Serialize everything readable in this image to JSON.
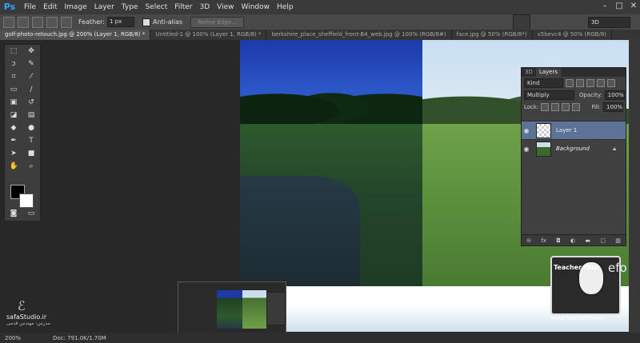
{
  "app": {
    "logo": "Ps"
  },
  "menu": [
    "File",
    "Edit",
    "Image",
    "Layer",
    "Type",
    "Select",
    "Filter",
    "3D",
    "View",
    "Window",
    "Help"
  ],
  "window_controls": [
    "–",
    "□",
    "✕"
  ],
  "options": {
    "feather_label": "Feather:",
    "feather_value": "1 px",
    "antialias_label": "Anti-alias",
    "refine_edge": "Refine Edge...",
    "workspace": "3D"
  },
  "tabs": [
    "golf-photo-retouch.jpg @ 200% (Layer 1, RGB/8) *",
    "Untitled-1 @ 100% (Layer 1, RGB/8) *",
    "berkshire_place_sheffield_front-B4_web.jpg @ 100% (RGB/8#)",
    "face.jpg @ 50% (RGB/8*)",
    "v5bevc4 @ 50% (RGB/8)"
  ],
  "layers_panel": {
    "tabs": [
      "3D",
      "Layers"
    ],
    "kind": "Kind",
    "blend_mode": "Multiply",
    "opacity_label": "Opacity:",
    "opacity_value": "100%",
    "lock_label": "Lock:",
    "fill_label": "Fill:",
    "fill_value": "100%",
    "layers": [
      {
        "name": "Layer 1",
        "selected": true
      },
      {
        "name": "Background",
        "selected": false
      }
    ],
    "footer_icons": [
      "link-icon",
      "fx-icon",
      "mask-icon",
      "adjustment-icon",
      "folder-icon",
      "new-layer-icon",
      "trash-icon"
    ]
  },
  "status": {
    "zoom": "200%",
    "doc": "Doc: 791.0K/1.70M"
  },
  "watermark_left": {
    "site": "safaStudio.ir",
    "sub": "مدرس: مهندس قدمی"
  },
  "watermark_right": {
    "url": "www.TeacherMan.ir",
    "tag": "Teacher Man",
    "efo": "efo"
  },
  "colors": {
    "accent": "#31a8ff",
    "selected_layer": "#5d7396"
  }
}
